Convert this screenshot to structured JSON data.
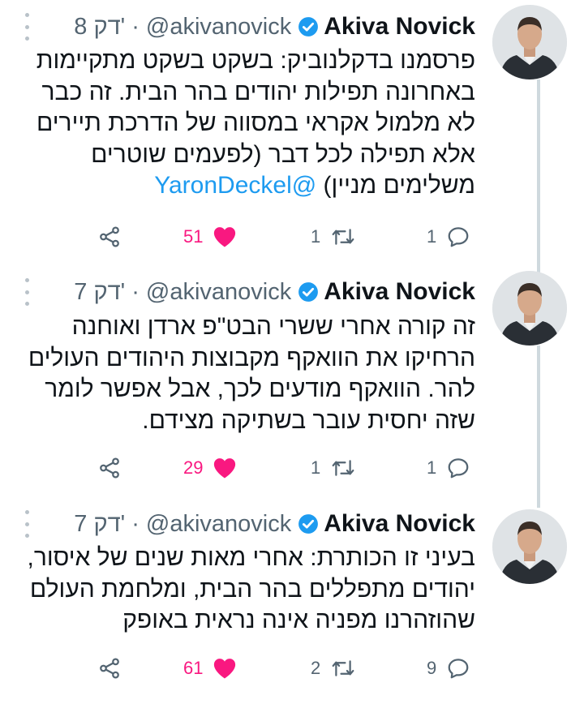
{
  "tweets": [
    {
      "author": "Akiva Novick",
      "handle": "@akivanovick",
      "separator": "·",
      "time": "8 דק'",
      "text_lines": [
        "פרסמנו בדקלנוביק: בשקט בשקט מתקיימות",
        "באחרונה תפילות יהודים בהר הבית. זה כבר",
        "לא מלמול אקראי במסווה של הדרכת תיירים",
        "אלא תפילה לכל דבר (לפעמים שוטרים"
      ],
      "last_line_text": "משלימים מניין) ",
      "mention": "@YaronDeckel",
      "replies": "1",
      "retweets": "1",
      "likes": "51"
    },
    {
      "author": "Akiva Novick",
      "handle": "@akivanovick",
      "separator": "·",
      "time": "7 דק'",
      "text_lines": [
        "זה קורה אחרי ששרי הבט\"פ ארדן ואוחנה",
        "הרחיקו את הוואקף מקבוצות היהודים העולים",
        "להר. הוואקף מודעים לכך, אבל אפשר לומר",
        "שזה יחסית עובר בשתיקה מצידם."
      ],
      "replies": "1",
      "retweets": "1",
      "likes": "29"
    },
    {
      "author": "Akiva Novick",
      "handle": "@akivanovick",
      "separator": "·",
      "time": "7 דק'",
      "text_lines": [
        "בעיני זו הכותרת: אחרי מאות שנים של איסור,",
        "יהודים מתפללים בהר הבית, ומלחמת העולם",
        "שהוזהרנו מפניה אינה נראית באופק"
      ],
      "replies": "9",
      "retweets": "2",
      "likes": "61"
    }
  ],
  "colors": {
    "like": "#f91880",
    "mention": "#1d9bf0",
    "verified": "#1d9bf0",
    "secondary_text": "#536471"
  }
}
